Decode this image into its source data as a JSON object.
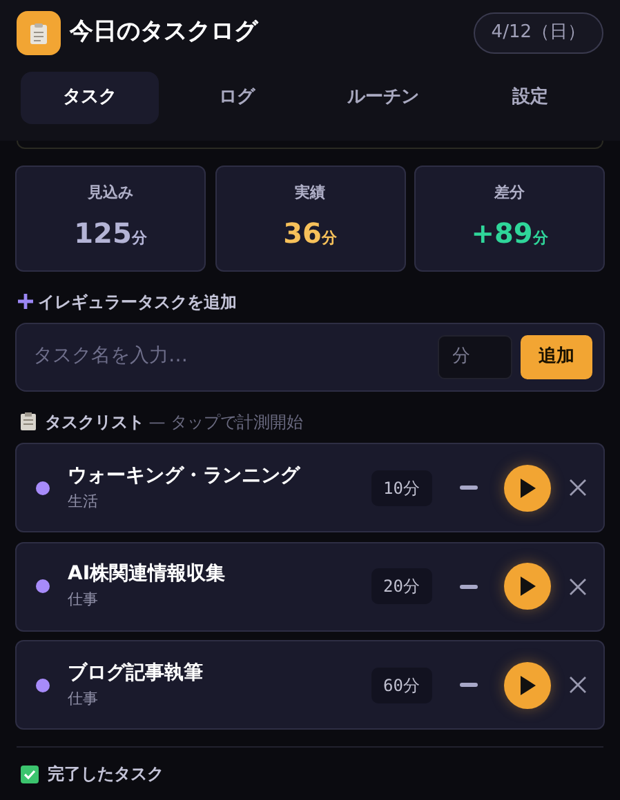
{
  "header": {
    "title": "今日のタスクログ",
    "date": "4/12（日）"
  },
  "tabs": [
    {
      "label": "タスク",
      "selected": true
    },
    {
      "label": "ログ",
      "selected": false
    },
    {
      "label": "ルーチン",
      "selected": false
    },
    {
      "label": "設定",
      "selected": false
    }
  ],
  "stats": [
    {
      "label": "見込み",
      "value": "125",
      "unit": "分",
      "color": "#b4b4d6"
    },
    {
      "label": "実績",
      "value": "36",
      "unit": "分",
      "color": "#f7c15a"
    },
    {
      "label": "差分",
      "value": "+89",
      "unit": "分",
      "color": "#2fd69a"
    }
  ],
  "add_section": {
    "title": "イレギュラータスクを追加",
    "name_placeholder": "タスク名を入力…",
    "minutes_placeholder": "分",
    "button": "追加"
  },
  "task_list": {
    "title": "タスクリスト",
    "hint": "— タップで計測開始"
  },
  "tasks": [
    {
      "name": "ウォーキング・ランニング",
      "category": "生活",
      "minutes": "10分",
      "color": "#a78bfa"
    },
    {
      "name": "AI株関連情報収集",
      "category": "仕事",
      "minutes": "20分",
      "color": "#a78bfa"
    },
    {
      "name": "ブログ記事執筆",
      "category": "仕事",
      "minutes": "60分",
      "color": "#a78bfa"
    }
  ],
  "completed": {
    "title": "完了したタスク"
  }
}
